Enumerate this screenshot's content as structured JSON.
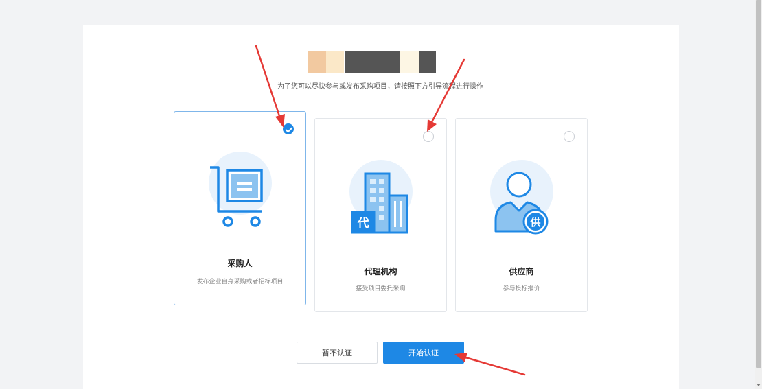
{
  "subtitle": "为了您可以尽快参与或发布采购项目，请按照下方引导流程进行操作",
  "cards": [
    {
      "title": "采购人",
      "desc": "发布企业自身采购或者招标项目",
      "selected": true,
      "icon": "shopping-cart-icon"
    },
    {
      "title": "代理机构",
      "desc": "接受项目委托采购",
      "selected": false,
      "icon": "building-icon",
      "badge": "代"
    },
    {
      "title": "供应商",
      "desc": "参与投标报价",
      "selected": false,
      "icon": "supplier-user-icon",
      "badge": "供"
    }
  ],
  "buttons": {
    "skip": "暂不认证",
    "start": "开始认证"
  },
  "colors": {
    "accent": "#1e88e5",
    "arrow": "#e53935",
    "icon_bg": "#e8f2fc"
  },
  "logo_blocks": [
    "#f2c9a0",
    "#fbe8c8",
    "#555555",
    "#fdf6e4",
    "#555555"
  ]
}
